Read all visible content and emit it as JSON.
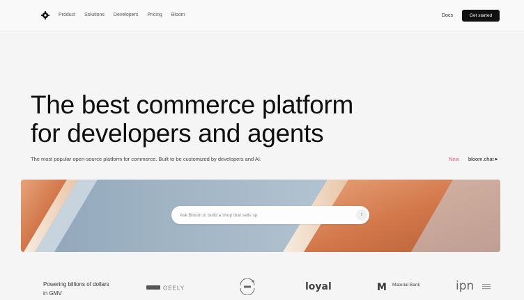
{
  "nav": {
    "logo_icon": "gear-icon",
    "links": [
      "Product",
      "Solutions",
      "Developers",
      "Pricing",
      "Bloom"
    ],
    "docs": "Docs",
    "cta": "Get started"
  },
  "hero": {
    "title_line1": "The best commerce platform",
    "title_line2": "for developers and agents",
    "subtitle": "The most popular open-source platform for commerce. Built to be customized by developers and AI.",
    "new_label": "New",
    "chat_link": "bloom.chat",
    "chat_arrow_icon": "triangle-right-icon",
    "prompt_placeholder": "Ask Bloom to build a shop that sells sp",
    "send_icon": "arrow-up-icon",
    "banner_colors": {
      "orange": "#d98553",
      "steel": "#a9bccb",
      "cream": "#f3e6d8"
    }
  },
  "logos": {
    "tagline": "Powering billions of dollars in GMV",
    "geely": "GEELY",
    "loyal": "loyal",
    "material_bank": "Material Bank",
    "ipn": "ipn"
  },
  "colors": {
    "accent": "#111111",
    "new": "#e0566b",
    "background": "#f5f5f6"
  }
}
